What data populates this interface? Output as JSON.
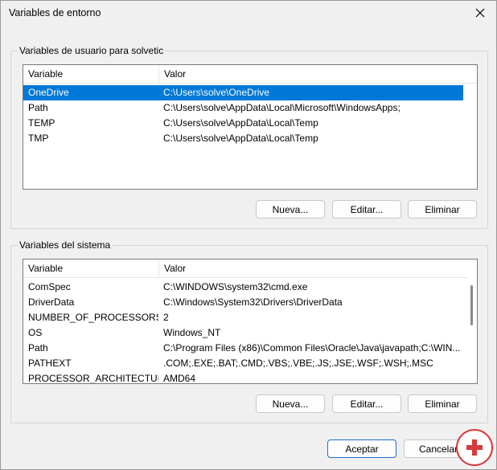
{
  "window": {
    "title": "Variables de entorno",
    "close_icon": "close-icon"
  },
  "user_vars": {
    "group_label": "Variables de usuario para solvetic",
    "headers": {
      "variable": "Variable",
      "value": "Valor"
    },
    "rows": [
      {
        "variable": "OneDrive",
        "value": "C:\\Users\\solve\\OneDrive",
        "selected": true
      },
      {
        "variable": "Path",
        "value": "C:\\Users\\solve\\AppData\\Local\\Microsoft\\WindowsApps;",
        "selected": false
      },
      {
        "variable": "TEMP",
        "value": "C:\\Users\\solve\\AppData\\Local\\Temp",
        "selected": false
      },
      {
        "variable": "TMP",
        "value": "C:\\Users\\solve\\AppData\\Local\\Temp",
        "selected": false
      }
    ],
    "buttons": {
      "new": "Nueva...",
      "edit": "Editar...",
      "delete": "Eliminar"
    }
  },
  "system_vars": {
    "group_label": "Variables del sistema",
    "headers": {
      "variable": "Variable",
      "value": "Valor"
    },
    "rows": [
      {
        "variable": "ComSpec",
        "value": "C:\\WINDOWS\\system32\\cmd.exe"
      },
      {
        "variable": "DriverData",
        "value": "C:\\Windows\\System32\\Drivers\\DriverData"
      },
      {
        "variable": "NUMBER_OF_PROCESSORS",
        "value": "2"
      },
      {
        "variable": "OS",
        "value": "Windows_NT"
      },
      {
        "variable": "Path",
        "value": "C:\\Program Files (x86)\\Common Files\\Oracle\\Java\\javapath;C:\\WIN..."
      },
      {
        "variable": "PATHEXT",
        "value": ".COM;.EXE;.BAT;.CMD;.VBS;.VBE;.JS;.JSE;.WSF;.WSH;.MSC"
      },
      {
        "variable": "PROCESSOR_ARCHITECTURE",
        "value": "AMD64"
      }
    ],
    "buttons": {
      "new": "Nueva...",
      "edit": "Editar...",
      "delete": "Eliminar"
    }
  },
  "footer": {
    "accept": "Aceptar",
    "cancel": "Cancelar"
  },
  "colors": {
    "selection": "#0078d7",
    "primary_border": "#1a6fd1",
    "watermark": "#d53a3a"
  }
}
